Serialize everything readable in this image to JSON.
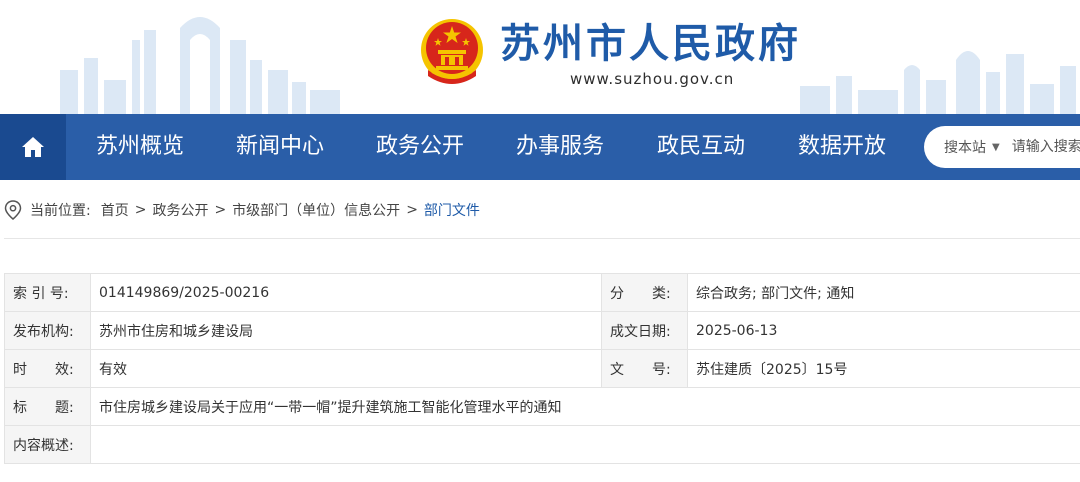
{
  "header": {
    "site_name": "苏州市人民政府",
    "site_url": "www.suzhou.gov.cn"
  },
  "nav": {
    "home_icon": "home-icon",
    "items": [
      "苏州概览",
      "新闻中心",
      "政务公开",
      "办事服务",
      "政民互动",
      "数据开放"
    ],
    "search": {
      "scope": "搜本站",
      "placeholder": "请输入搜索"
    }
  },
  "breadcrumb": {
    "prefix": "当前位置:",
    "items": [
      "首页",
      "政务公开",
      "市级部门（单位）信息公开",
      "部门文件"
    ],
    "separator": ">"
  },
  "info": {
    "index_label": "索 引 号:",
    "index_value": "014149869/2025-00216",
    "category_label": "分　　类:",
    "category_value": "综合政务;  部门文件;  通知",
    "publisher_label": "发布机构:",
    "publisher_value": "苏州市住房和城乡建设局",
    "date_label": "成文日期:",
    "date_value": "2025-06-13",
    "validity_label": "时　　效:",
    "validity_value": "有效",
    "doc_no_label": "文　　号:",
    "doc_no_value": "苏住建质〔2025〕15号",
    "title_label": "标　　题:",
    "title_value": "市住房城乡建设局关于应用“一带一帽”提升建筑施工智能化管理水平的通知",
    "summary_label": "内容概述:",
    "summary_value": ""
  },
  "colors": {
    "brand_blue": "#1f5ba8",
    "nav_bg": "#2a5ea8",
    "home_bg": "#1a4a90",
    "emblem_red": "#d7261b",
    "emblem_gold": "#f5c400"
  }
}
